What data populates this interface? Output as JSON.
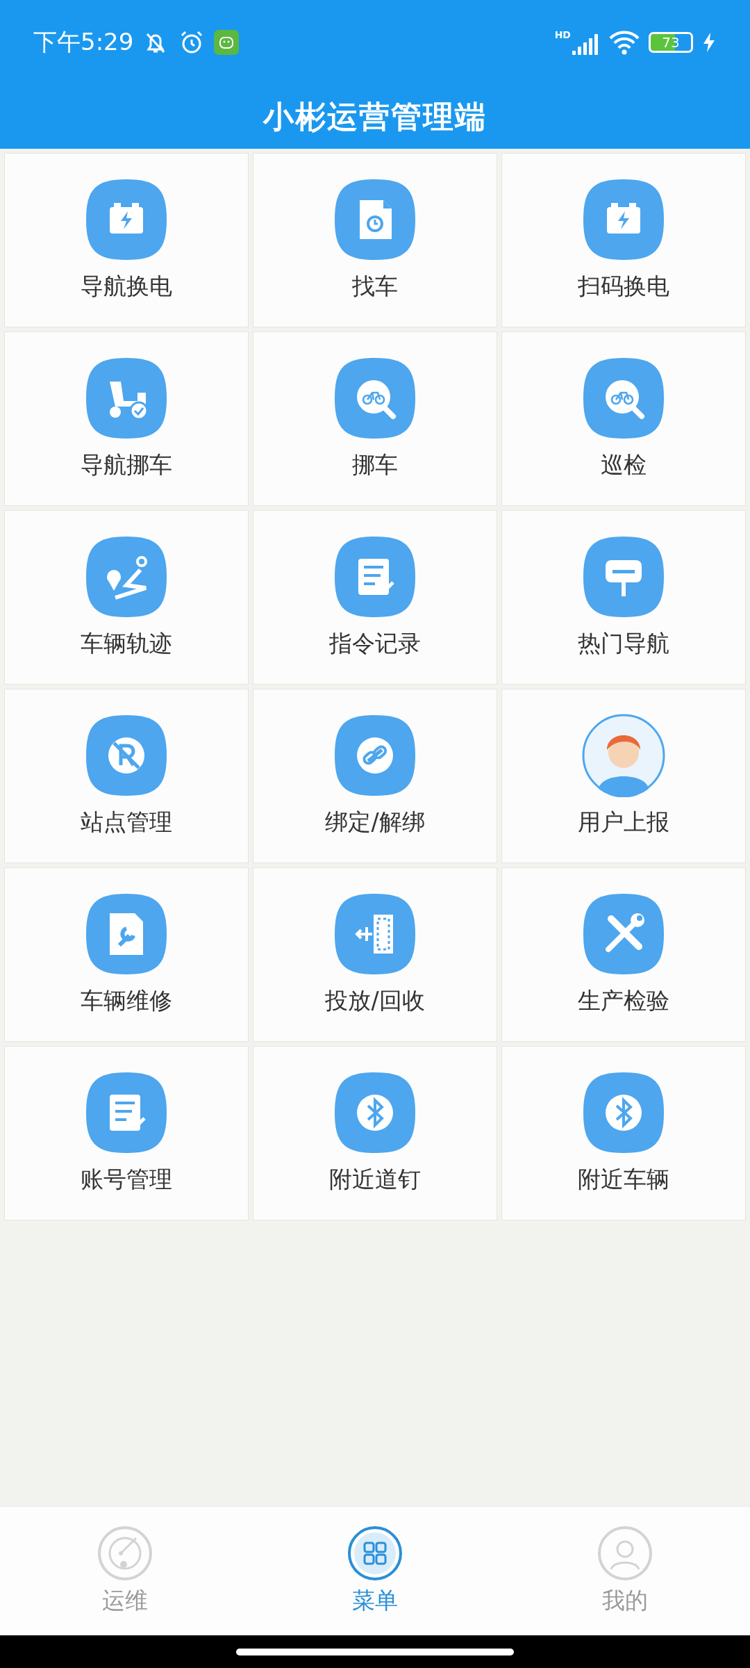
{
  "status_bar": {
    "time": "下午5:29",
    "network": "HD",
    "battery": "73"
  },
  "header": {
    "title": "小彬运营管理端"
  },
  "menu": [
    {
      "label": "导航换电",
      "kind": "battery"
    },
    {
      "label": "找车",
      "kind": "locate"
    },
    {
      "label": "扫码换电",
      "kind": "battery"
    },
    {
      "label": "导航挪车",
      "kind": "scooter"
    },
    {
      "label": "挪车",
      "kind": "bike"
    },
    {
      "label": "巡检",
      "kind": "bike"
    },
    {
      "label": "车辆轨迹",
      "kind": "route"
    },
    {
      "label": "指令记录",
      "kind": "list"
    },
    {
      "label": "热门导航",
      "kind": "sign"
    },
    {
      "label": "站点管理",
      "kind": "noparking"
    },
    {
      "label": "绑定/解绑",
      "kind": "link"
    },
    {
      "label": "用户上报",
      "kind": "avatar"
    },
    {
      "label": "车辆维修",
      "kind": "repair"
    },
    {
      "label": "投放/回收",
      "kind": "deploy"
    },
    {
      "label": "生产检验",
      "kind": "tools"
    },
    {
      "label": "账号管理",
      "kind": "list"
    },
    {
      "label": "附近道钉",
      "kind": "bluetooth"
    },
    {
      "label": "附近车辆",
      "kind": "bluetooth"
    }
  ],
  "tabs": [
    {
      "label": "运维",
      "kind": "radar",
      "selected": false
    },
    {
      "label": "菜单",
      "kind": "grid",
      "selected": true
    },
    {
      "label": "我的",
      "kind": "person",
      "selected": false
    }
  ]
}
